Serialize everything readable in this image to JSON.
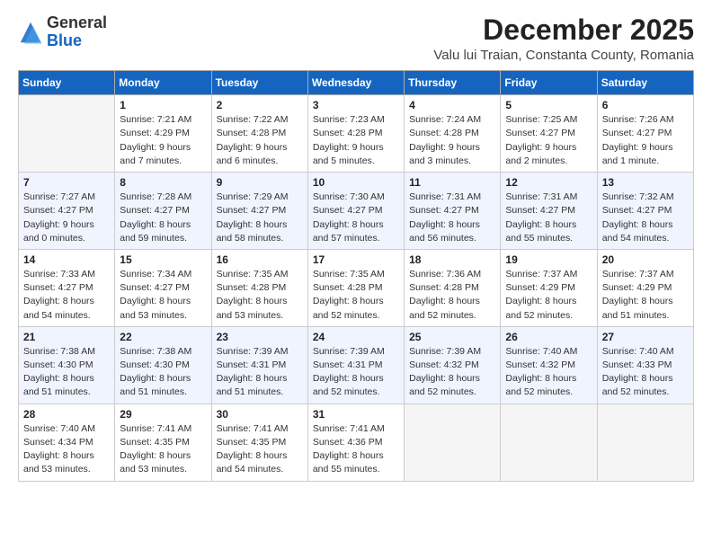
{
  "logo": {
    "general": "General",
    "blue": "Blue"
  },
  "header": {
    "month": "December 2025",
    "location": "Valu lui Traian, Constanta County, Romania"
  },
  "weekdays": [
    "Sunday",
    "Monday",
    "Tuesday",
    "Wednesday",
    "Thursday",
    "Friday",
    "Saturday"
  ],
  "weeks": [
    [
      {
        "day": "",
        "content": ""
      },
      {
        "day": "1",
        "content": "Sunrise: 7:21 AM\nSunset: 4:29 PM\nDaylight: 9 hours\nand 7 minutes."
      },
      {
        "day": "2",
        "content": "Sunrise: 7:22 AM\nSunset: 4:28 PM\nDaylight: 9 hours\nand 6 minutes."
      },
      {
        "day": "3",
        "content": "Sunrise: 7:23 AM\nSunset: 4:28 PM\nDaylight: 9 hours\nand 5 minutes."
      },
      {
        "day": "4",
        "content": "Sunrise: 7:24 AM\nSunset: 4:28 PM\nDaylight: 9 hours\nand 3 minutes."
      },
      {
        "day": "5",
        "content": "Sunrise: 7:25 AM\nSunset: 4:27 PM\nDaylight: 9 hours\nand 2 minutes."
      },
      {
        "day": "6",
        "content": "Sunrise: 7:26 AM\nSunset: 4:27 PM\nDaylight: 9 hours\nand 1 minute."
      }
    ],
    [
      {
        "day": "7",
        "content": "Sunrise: 7:27 AM\nSunset: 4:27 PM\nDaylight: 9 hours\nand 0 minutes."
      },
      {
        "day": "8",
        "content": "Sunrise: 7:28 AM\nSunset: 4:27 PM\nDaylight: 8 hours\nand 59 minutes."
      },
      {
        "day": "9",
        "content": "Sunrise: 7:29 AM\nSunset: 4:27 PM\nDaylight: 8 hours\nand 58 minutes."
      },
      {
        "day": "10",
        "content": "Sunrise: 7:30 AM\nSunset: 4:27 PM\nDaylight: 8 hours\nand 57 minutes."
      },
      {
        "day": "11",
        "content": "Sunrise: 7:31 AM\nSunset: 4:27 PM\nDaylight: 8 hours\nand 56 minutes."
      },
      {
        "day": "12",
        "content": "Sunrise: 7:31 AM\nSunset: 4:27 PM\nDaylight: 8 hours\nand 55 minutes."
      },
      {
        "day": "13",
        "content": "Sunrise: 7:32 AM\nSunset: 4:27 PM\nDaylight: 8 hours\nand 54 minutes."
      }
    ],
    [
      {
        "day": "14",
        "content": "Sunrise: 7:33 AM\nSunset: 4:27 PM\nDaylight: 8 hours\nand 54 minutes."
      },
      {
        "day": "15",
        "content": "Sunrise: 7:34 AM\nSunset: 4:27 PM\nDaylight: 8 hours\nand 53 minutes."
      },
      {
        "day": "16",
        "content": "Sunrise: 7:35 AM\nSunset: 4:28 PM\nDaylight: 8 hours\nand 53 minutes."
      },
      {
        "day": "17",
        "content": "Sunrise: 7:35 AM\nSunset: 4:28 PM\nDaylight: 8 hours\nand 52 minutes."
      },
      {
        "day": "18",
        "content": "Sunrise: 7:36 AM\nSunset: 4:28 PM\nDaylight: 8 hours\nand 52 minutes."
      },
      {
        "day": "19",
        "content": "Sunrise: 7:37 AM\nSunset: 4:29 PM\nDaylight: 8 hours\nand 52 minutes."
      },
      {
        "day": "20",
        "content": "Sunrise: 7:37 AM\nSunset: 4:29 PM\nDaylight: 8 hours\nand 51 minutes."
      }
    ],
    [
      {
        "day": "21",
        "content": "Sunrise: 7:38 AM\nSunset: 4:30 PM\nDaylight: 8 hours\nand 51 minutes."
      },
      {
        "day": "22",
        "content": "Sunrise: 7:38 AM\nSunset: 4:30 PM\nDaylight: 8 hours\nand 51 minutes."
      },
      {
        "day": "23",
        "content": "Sunrise: 7:39 AM\nSunset: 4:31 PM\nDaylight: 8 hours\nand 51 minutes."
      },
      {
        "day": "24",
        "content": "Sunrise: 7:39 AM\nSunset: 4:31 PM\nDaylight: 8 hours\nand 52 minutes."
      },
      {
        "day": "25",
        "content": "Sunrise: 7:39 AM\nSunset: 4:32 PM\nDaylight: 8 hours\nand 52 minutes."
      },
      {
        "day": "26",
        "content": "Sunrise: 7:40 AM\nSunset: 4:32 PM\nDaylight: 8 hours\nand 52 minutes."
      },
      {
        "day": "27",
        "content": "Sunrise: 7:40 AM\nSunset: 4:33 PM\nDaylight: 8 hours\nand 52 minutes."
      }
    ],
    [
      {
        "day": "28",
        "content": "Sunrise: 7:40 AM\nSunset: 4:34 PM\nDaylight: 8 hours\nand 53 minutes."
      },
      {
        "day": "29",
        "content": "Sunrise: 7:41 AM\nSunset: 4:35 PM\nDaylight: 8 hours\nand 53 minutes."
      },
      {
        "day": "30",
        "content": "Sunrise: 7:41 AM\nSunset: 4:35 PM\nDaylight: 8 hours\nand 54 minutes."
      },
      {
        "day": "31",
        "content": "Sunrise: 7:41 AM\nSunset: 4:36 PM\nDaylight: 8 hours\nand 55 minutes."
      },
      {
        "day": "",
        "content": ""
      },
      {
        "day": "",
        "content": ""
      },
      {
        "day": "",
        "content": ""
      }
    ]
  ]
}
